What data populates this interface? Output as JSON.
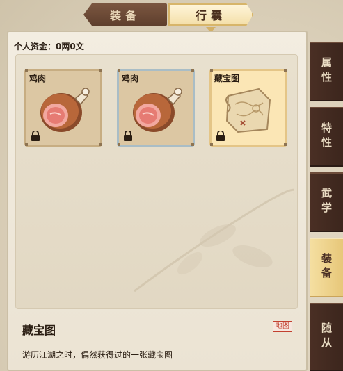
{
  "tabs": {
    "equip": "装备",
    "bag": "行囊"
  },
  "funds": "个人资金：0两0文",
  "slots": [
    {
      "name": "鸡肉",
      "icon": "ham-icon",
      "locked": true
    },
    {
      "name": "鸡肉",
      "icon": "ham-icon",
      "locked": true
    },
    {
      "name": "藏宝图",
      "icon": "treasure-map-icon",
      "locked": true
    }
  ],
  "detail": {
    "title": "藏宝图",
    "tag": "地图",
    "description": "游历江湖之时，偶然获得过的一张藏宝图"
  },
  "side_menu": [
    {
      "label": "属性",
      "active": false
    },
    {
      "label": "特性",
      "active": false
    },
    {
      "label": "武学",
      "active": false
    },
    {
      "label": "装备",
      "active": true
    },
    {
      "label": "随从",
      "active": false
    }
  ],
  "colors": {
    "accent_gold": "#e7c779",
    "dark_wood": "#4a2f24",
    "tag_red": "#c2402f"
  }
}
